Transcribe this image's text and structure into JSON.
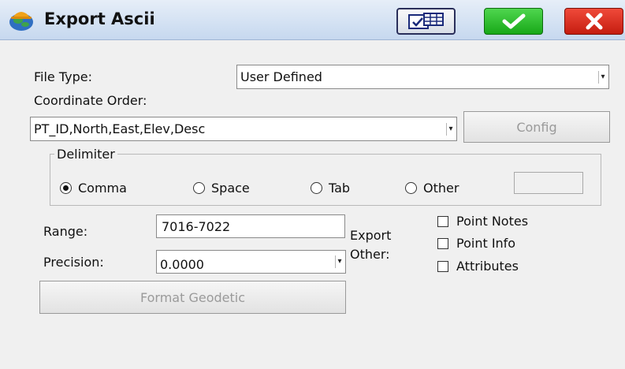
{
  "window": {
    "title": "Export Ascii"
  },
  "toolbar": {
    "grid_icon": "table-icon",
    "ok_icon": "checkmark-icon",
    "cancel_icon": "x-icon",
    "ok_color": "#22b022",
    "cancel_color": "#d9261a"
  },
  "file_type": {
    "label": "File Type:",
    "value": "User Defined"
  },
  "coordinate_order": {
    "label": "Coordinate Order:",
    "value": "PT_ID,North,East,Elev,Desc",
    "config_label": "Config"
  },
  "delimiter": {
    "title": "Delimiter",
    "options": [
      "Comma",
      "Space",
      "Tab",
      "Other"
    ],
    "selected": "Comma",
    "other_value": ""
  },
  "range": {
    "label": "Range:",
    "value": "7016-7022"
  },
  "precision": {
    "label": "Precision:",
    "value": "0.0000"
  },
  "export_other": {
    "label_line1": "Export",
    "label_line2": "Other:",
    "options": [
      "Point Notes",
      "Point Info",
      "Attributes"
    ]
  },
  "format_geodetic": {
    "label": "Format Geodetic"
  }
}
